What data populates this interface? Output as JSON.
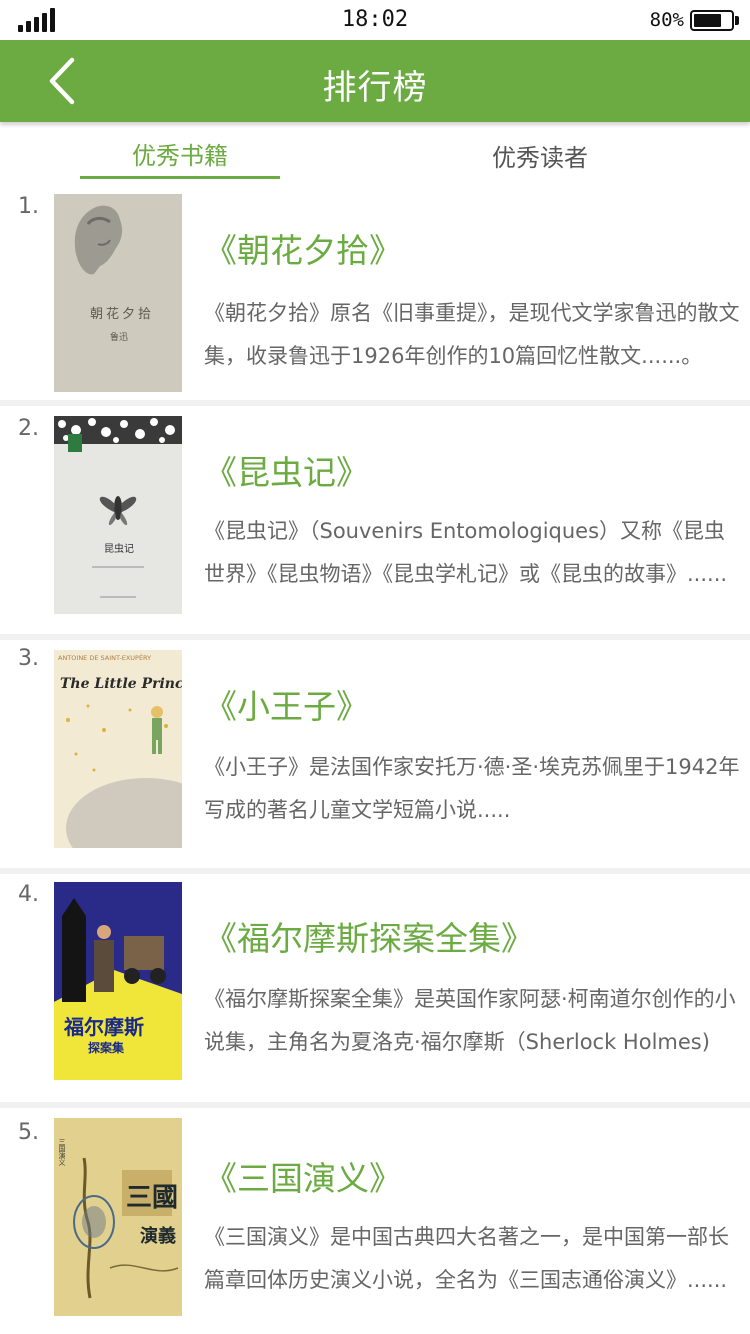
{
  "status_bar": {
    "time": "18:02",
    "battery_percent": "80%",
    "battery_level": 0.8,
    "signal_icon": "signal-bars-icon"
  },
  "header": {
    "title": "排行榜",
    "back_icon": "chevron-left-icon"
  },
  "tabs": {
    "books_label": "优秀书籍",
    "readers_label": "优秀读者",
    "active": "books"
  },
  "colors": {
    "accent": "#6bab42",
    "description_text": "#666666",
    "divider": "#f1f1f1"
  },
  "books": [
    {
      "rank": "1.",
      "title": "《朝花夕拾》",
      "description": "《朝花夕拾》原名《旧事重提》，是现代文学家鲁迅的散文集，收录鲁迅于1926年创作的10篇回忆性散文......。",
      "cover": {
        "text": "朝花夕拾",
        "author_mark": "鲁迅"
      }
    },
    {
      "rank": "2.",
      "title": "《昆虫记》",
      "description": "《昆虫记》（Souvenirs Entomologiques）又称《昆虫世界》《昆虫物语》《昆虫学札记》或《昆虫的故事》......",
      "cover": {
        "text": "昆虫记"
      }
    },
    {
      "rank": "3.",
      "title": "《小王子》",
      "description": "《小王子》是法国作家安托万·德·圣·埃克苏佩里于1942年写成的著名儿童文学短篇小说.....",
      "cover": {
        "author": "ANTOINE DE SAINT-EXUPÉRY",
        "text": "The Little Prince"
      }
    },
    {
      "rank": "4.",
      "title": "《福尔摩斯探案全集》",
      "description": "《福尔摩斯探案全集》是英国作家阿瑟·柯南道尔创作的小说集，主角名为夏洛克·福尔摩斯（Sherlock Holmes)",
      "cover": {
        "text": "福尔摩斯",
        "subtext": "探案集"
      }
    },
    {
      "rank": "5.",
      "title": "《三国演义》",
      "description": "《三国演义》是中国古典四大名著之一，是中国第一部长篇章回体历史演义小说，全名为《三国志通俗演义》......",
      "cover": {
        "text": "三國",
        "subtext": "演義",
        "spine": "三国演义"
      }
    }
  ]
}
